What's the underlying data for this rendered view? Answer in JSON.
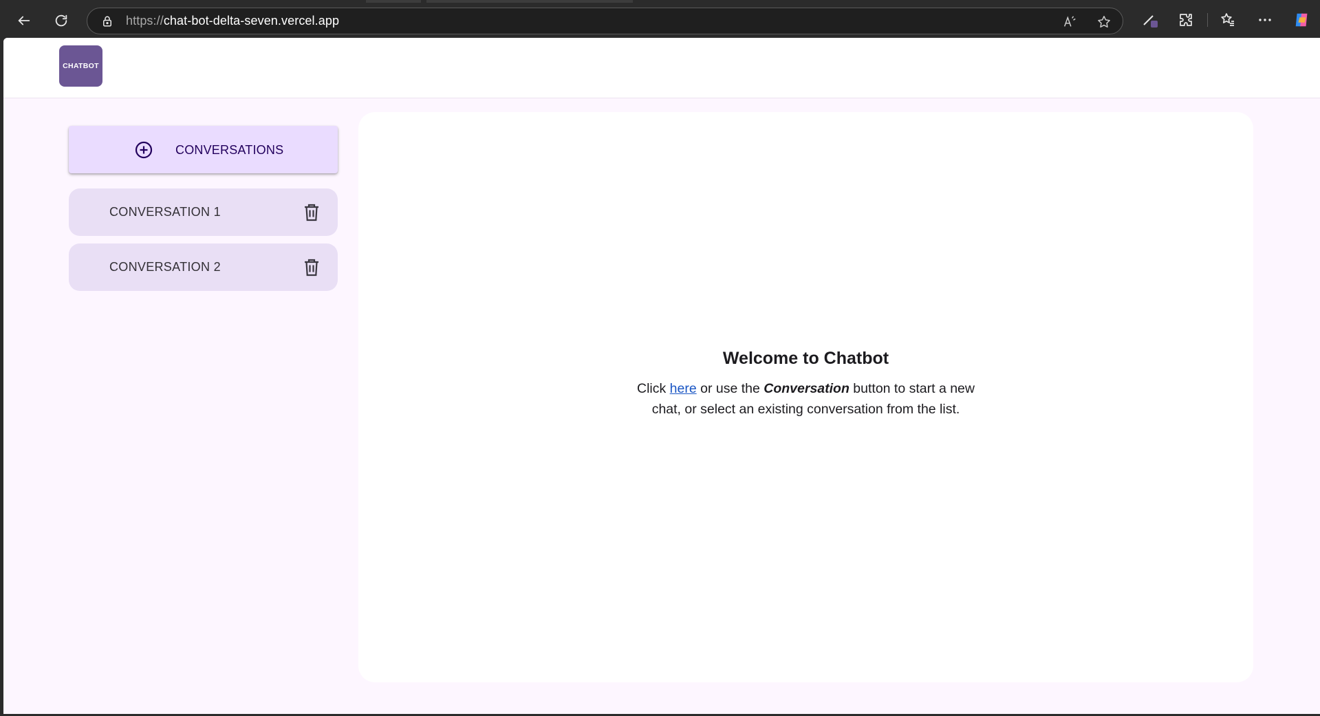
{
  "browser": {
    "url_scheme": "https://",
    "url_host": "chat-bot-delta-seven.vercel.app",
    "icons": [
      "back-icon",
      "refresh-icon",
      "lock-icon",
      "read-aloud-icon",
      "favorite-star-icon",
      "pen-icon",
      "extensions-icon",
      "favorites-icon",
      "more-icon",
      "copilot-icon"
    ]
  },
  "header": {
    "logo_text": "CHATBOT"
  },
  "sidebar": {
    "new_conversation_label": "CONVERSATIONS",
    "conversations": [
      {
        "label": "CONVERSATION 1"
      },
      {
        "label": "CONVERSATION 2"
      }
    ]
  },
  "main": {
    "welcome_title": "Welcome to Chatbot",
    "text_click": "Click ",
    "link_here": "here",
    "text_or_use": " or use the ",
    "emph_conversation": "Conversation",
    "text_rest": " button to start a new chat, or select an existing conversation from the list."
  },
  "colors": {
    "brand": "#6b5694",
    "primary_container": "#eadcff",
    "surface_container": "#e9dff5",
    "background": "#fdf6ff",
    "link": "#1a56c4"
  }
}
